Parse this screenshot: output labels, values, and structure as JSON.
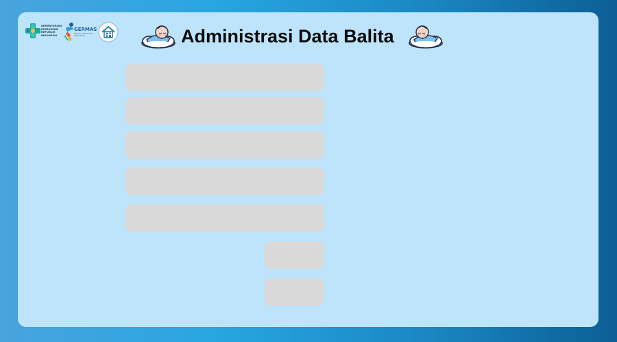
{
  "header": {
    "title": "Administrasi Data Balita",
    "logos": {
      "kemenkes_text": "KEMENTERIAN KESEHATAN REPUBLIK INDONESIA",
      "germas_text": "GERMAS",
      "germas_subtitle": "Gerakan Masyarakat Hidup Sehat",
      "posyandu_icon": "posyandu-house-icon"
    },
    "decorations": [
      "baby-on-cloud-icon",
      "baby-on-cloud-icon"
    ]
  },
  "form": {
    "fields": [
      {
        "value": "",
        "placeholder": ""
      },
      {
        "value": "",
        "placeholder": ""
      },
      {
        "value": "",
        "placeholder": ""
      },
      {
        "value": "",
        "placeholder": ""
      },
      {
        "value": "",
        "placeholder": ""
      }
    ],
    "buttons": [
      {
        "label": ""
      },
      {
        "label": ""
      }
    ]
  },
  "colors": {
    "background_gradient": [
      "#4aa3dd",
      "#0c5e95"
    ],
    "card": "#bde4fb",
    "field": "#d9d9d9",
    "title": "#0a0a0a"
  }
}
